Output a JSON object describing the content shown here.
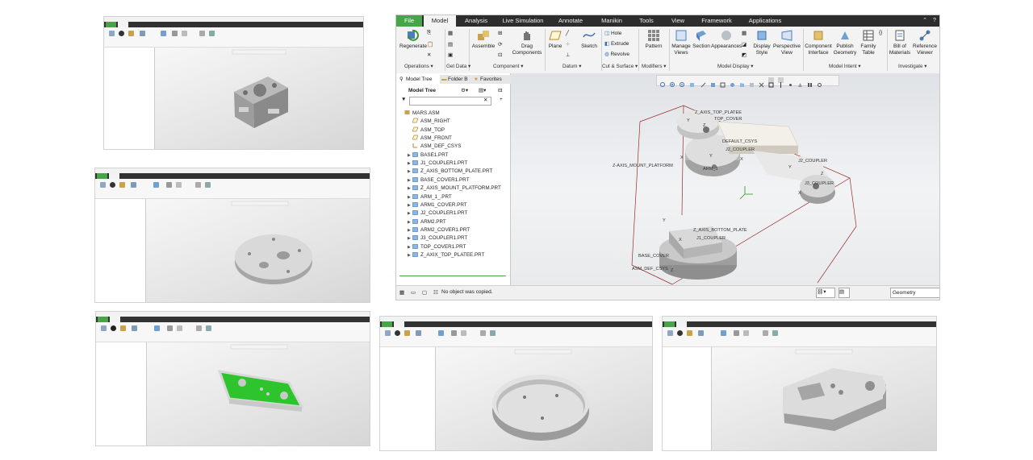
{
  "main_window": {
    "tabs": [
      "File",
      "Model",
      "Analysis",
      "Live Simulation",
      "Annotate",
      "Manikin",
      "Tools",
      "View",
      "Framework",
      "Applications"
    ],
    "ribbon": {
      "regenerate": "Regenerate",
      "assemble": "Assemble",
      "drag_components": "Drag Components",
      "plane": "Plane",
      "sketch": "Sketch",
      "hole": "Hole",
      "extrude": "Extrude",
      "revolve": "Revolve",
      "pattern": "Pattern",
      "manage_views": "Manage Views",
      "section": "Section",
      "appearances": "Appearances",
      "display_style": "Display Style",
      "perspective_view": "Perspective View",
      "component_interface": "Component Interface",
      "publish_geometry": "Publish Geometry",
      "family_table": "Family Table",
      "bill_of_materials": "Bill of Materials",
      "reference_viewer": "Reference Viewer"
    },
    "groups": [
      "Operations ▾",
      "Get Data ▾",
      "Component ▾",
      "Datum ▾",
      "Cut & Surface ▾",
      "Modifiers ▾",
      "Model Display ▾",
      "Model Intent ▾",
      "Investigate ▾"
    ],
    "panel_tabs": [
      "Model Tree",
      "Folder B",
      "Favorites"
    ],
    "tree_title": "Model Tree",
    "tree_items": [
      {
        "label": "MARS.ASM",
        "indent": 0,
        "icon": "asm-icon",
        "expand": false
      },
      {
        "label": "ASM_RIGHT",
        "indent": 1,
        "icon": "datum-plane-icon",
        "expand": false
      },
      {
        "label": "ASM_TOP",
        "indent": 1,
        "icon": "datum-plane-icon",
        "expand": false
      },
      {
        "label": "ASM_FRONT",
        "indent": 1,
        "icon": "datum-plane-icon",
        "expand": false
      },
      {
        "label": "ASM_DEF_CSYS",
        "indent": 1,
        "icon": "csys-icon",
        "expand": false
      },
      {
        "label": "BASE1.PRT",
        "indent": 1,
        "icon": "part-icon",
        "expand": true
      },
      {
        "label": "J1_COUPLER1.PRT",
        "indent": 1,
        "icon": "part-icon",
        "expand": true
      },
      {
        "label": "Z_AXIS_BOTTOM_PLATE.PRT",
        "indent": 1,
        "icon": "part-icon",
        "expand": true
      },
      {
        "label": "BASE_COVER1.PRT",
        "indent": 1,
        "icon": "part-icon",
        "expand": true
      },
      {
        "label": "Z_AXIS_MOUNT_PLATFORM.PRT",
        "indent": 1,
        "icon": "part-icon",
        "expand": true
      },
      {
        "label": "ARM_1_.PRT",
        "indent": 1,
        "icon": "part-icon",
        "expand": true
      },
      {
        "label": "ARM1_COVER.PRT",
        "indent": 1,
        "icon": "part-icon",
        "expand": true
      },
      {
        "label": "J2_COUPLER1.PRT",
        "indent": 1,
        "icon": "part-icon",
        "expand": true
      },
      {
        "label": "ARM2.PRT",
        "indent": 1,
        "icon": "part-icon",
        "expand": true
      },
      {
        "label": "ARM2_COVER1.PRT",
        "indent": 1,
        "icon": "part-icon",
        "expand": true
      },
      {
        "label": "J3_COUPLER1.PRT",
        "indent": 1,
        "icon": "part-icon",
        "expand": true
      },
      {
        "label": "TOP_COVER1.PRT",
        "indent": 1,
        "icon": "part-icon",
        "expand": true
      },
      {
        "label": "Z_AXIX_TOP_PLATEE.PRT",
        "indent": 1,
        "icon": "part-icon",
        "expand": true
      }
    ],
    "model_labels": {
      "top_plate": "Z_AXIS_TOP_PLATEE",
      "top_cover": "TOP_COVER",
      "default_csys": "DEFAULT_CSYS",
      "j2_coupler": "J2_COUPLER",
      "mount_platform": "Z-AXIS_MOUNT_PLATFORM",
      "arm": "ARM_1",
      "coupler": "J2_COUPLER",
      "j3_coupler": "J3_COUPLER",
      "bottom_plate": "Z_AXIS_BOTTOM_PLATE",
      "j1_coupler": "J1_COUPLER",
      "base_cover": "BASE_COVER",
      "asm_def_csys": "ASM_DEF_CSYS"
    },
    "status_message": "No object was copied.",
    "filter_value": "Geometry"
  },
  "accent_colors": {
    "file_tab": "#46a546",
    "tabbar": "#2d2d2d",
    "highlight_green": "#2ec42e"
  }
}
